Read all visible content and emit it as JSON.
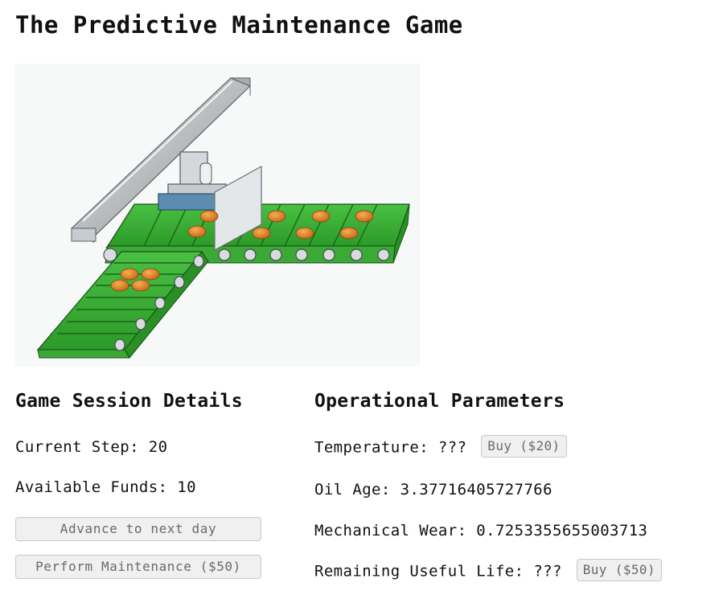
{
  "title": "The Predictive Maintenance Game",
  "image": {
    "icon": "conveyor-belt-robot-icon",
    "description_name": "conveyor-system-illustration"
  },
  "session": {
    "heading": "Game Session Details",
    "step_label": "Current Step:",
    "step_value": "20",
    "funds_label": "Available Funds:",
    "funds_value": "10",
    "advance_label": "Advance to next day",
    "maintenance_label": "Perform Maintenance ($50)"
  },
  "parameters": {
    "heading": "Operational Parameters",
    "temperature_label": "Temperature:",
    "temperature_value": "???",
    "temperature_buy": "Buy ($20)",
    "oil_label": "Oil Age:",
    "oil_value": "3.37716405727766",
    "wear_label": "Mechanical Wear:",
    "wear_value": "0.7253355655003713",
    "rul_label": "Remaining Useful Life:",
    "rul_value": "???",
    "rul_buy": "Buy ($50)"
  },
  "colors": {
    "belt_green": "#3fb33a",
    "belt_dark": "#1f6b1c",
    "item_orange": "#d97b1f",
    "rail_gray": "#b9bec2"
  }
}
